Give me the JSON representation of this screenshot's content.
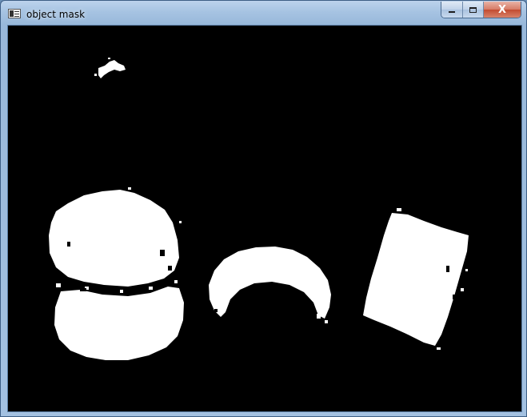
{
  "window": {
    "title": "object mask",
    "controls": {
      "minimize": "minimize",
      "maximize": "maximize",
      "close": "X"
    }
  },
  "image": {
    "kind": "binary mask",
    "background_color": "#000000",
    "foreground_color": "#ffffff"
  }
}
